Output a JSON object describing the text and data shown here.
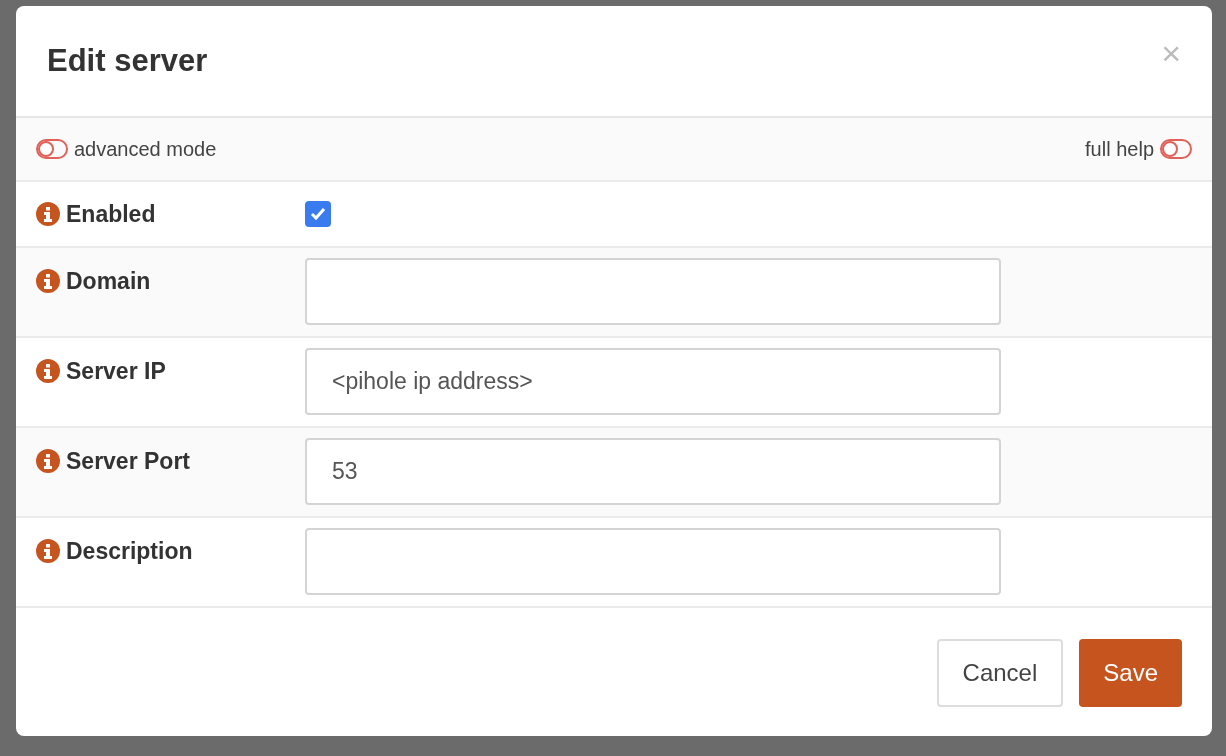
{
  "dialog": {
    "title": "Edit server",
    "close": "×"
  },
  "toggles": [
    {
      "label": "advanced mode",
      "on": false
    },
    {
      "label": "full help",
      "on": false
    }
  ],
  "fields": [
    {
      "kind": "checkbox",
      "label": "Enabled",
      "checked": true
    },
    {
      "kind": "text",
      "label": "Domain"
    },
    {
      "kind": "text",
      "label": "Server IP",
      "value": "<pihole ip address>"
    },
    {
      "kind": "text",
      "label": "Server Port",
      "value": "53"
    },
    {
      "kind": "text",
      "label": "Description"
    }
  ],
  "buttons": [
    {
      "label": "Cancel",
      "kind": "secondary"
    },
    {
      "label": "Save",
      "kind": "primary"
    }
  ]
}
